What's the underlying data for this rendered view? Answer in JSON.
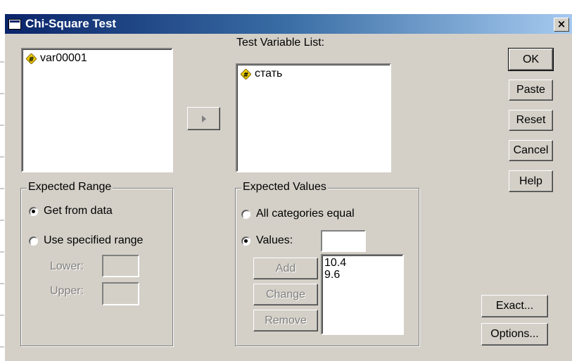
{
  "window": {
    "title": "Chi-Square Test",
    "close_label": "×"
  },
  "source_list": {
    "items": [
      {
        "name": "var00001",
        "icon": "numeric-variable-icon"
      }
    ]
  },
  "move_button": {
    "icon": "right-arrow-icon"
  },
  "test_variable_list": {
    "label": "Test Variable List:",
    "items": [
      {
        "name": "стать",
        "icon": "numeric-variable-icon"
      }
    ]
  },
  "buttons": {
    "ok": "OK",
    "paste": "Paste",
    "reset": "Reset",
    "cancel": "Cancel",
    "help": "Help",
    "exact": "Exact...",
    "options": "Options..."
  },
  "expected_range": {
    "title": "Expected Range",
    "option_get": "Get from data",
    "option_specified": "Use specified range",
    "selected": "get",
    "lower_label": "Lower:",
    "upper_label": "Upper:",
    "lower_value": "",
    "upper_value": ""
  },
  "expected_values": {
    "title": "Expected Values",
    "option_all_equal": "All categories equal",
    "option_values": "Values:",
    "selected": "values",
    "values_input": "",
    "add_label": "Add",
    "change_label": "Change",
    "remove_label": "Remove",
    "values_list": [
      "10.4",
      "9.6"
    ]
  },
  "colors": {
    "titlebar_start": "#0a246a",
    "titlebar_end": "#a6caf0",
    "dialog_bg": "#d4d0c8",
    "icon_yellow": "#f0d000"
  }
}
